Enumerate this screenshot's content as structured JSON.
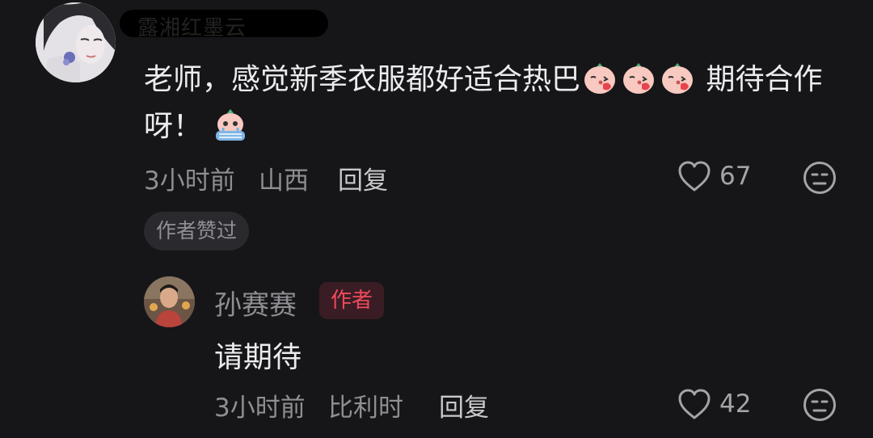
{
  "comment": {
    "username": "露湘红墨云",
    "text_part1": "老师，感觉新季衣服都好适合热巴",
    "text_part2": " 期待合作呀！",
    "time": "3小时前",
    "location": "山西",
    "reply_label": "回复",
    "likes": "67",
    "author_liked_chip": "作者赞过"
  },
  "reply": {
    "username": "孙赛赛",
    "author_badge": "作者",
    "text": "请期待",
    "time": "3小时前",
    "location": "比利时",
    "reply_label": "回复",
    "likes": "42"
  },
  "colors": {
    "background": "#161619",
    "author_badge_text": "#ee4a5c",
    "author_badge_bg": "#3a1d24",
    "secondary_text": "#8e8e93"
  },
  "icons": {
    "like": "heart-outline-icon",
    "dislike": "neutral-face-icon",
    "emoji_kiss": "kiss-face-emoji",
    "emoji_cry": "crying-face-emoji"
  }
}
